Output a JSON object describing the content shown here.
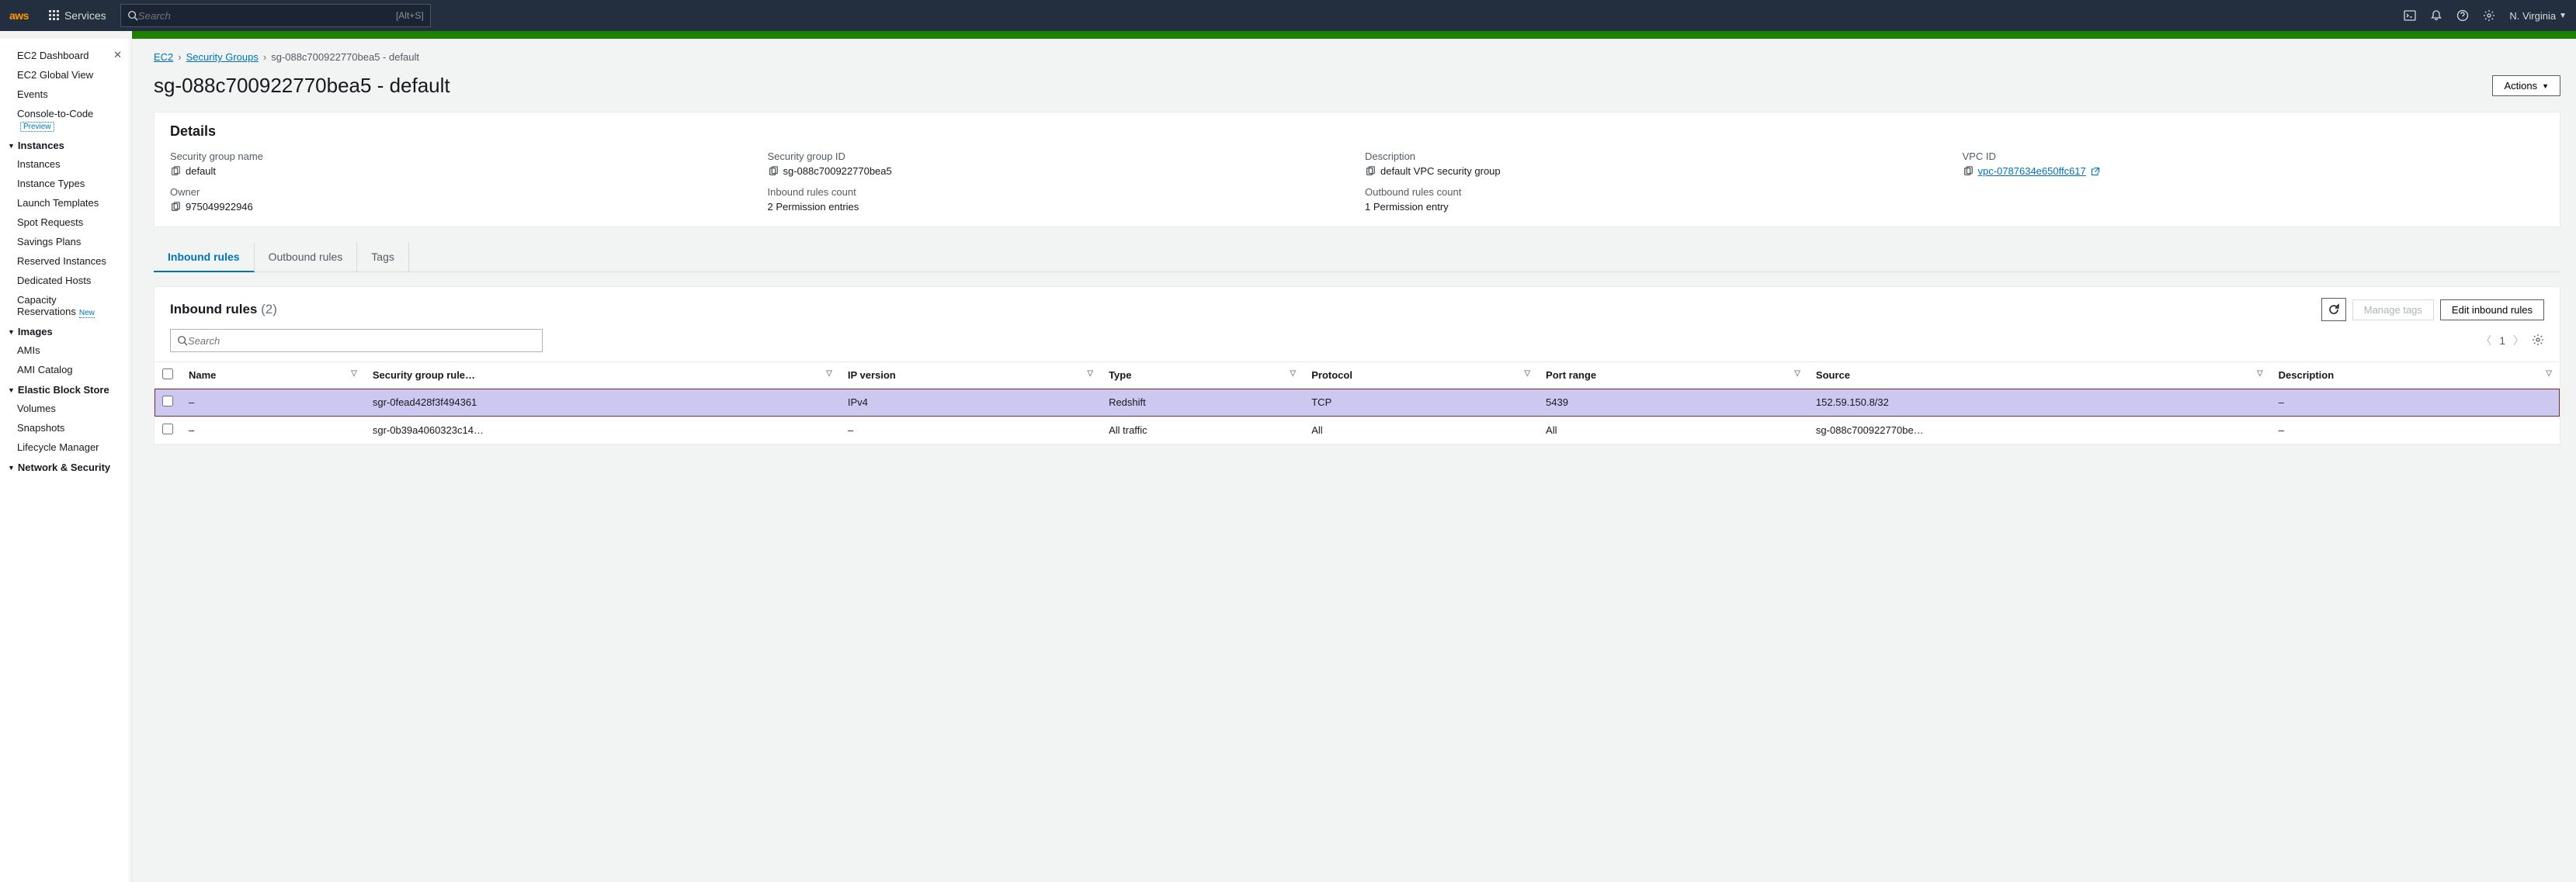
{
  "topnav": {
    "logo": "aws",
    "services_label": "Services",
    "search_placeholder": "Search",
    "search_shortcut": "[Alt+S]",
    "region": "N. Virginia"
  },
  "sidebar": {
    "top_items": [
      {
        "label": "EC2 Dashboard",
        "close": true
      },
      {
        "label": "EC2 Global View"
      },
      {
        "label": "Events"
      },
      {
        "label": "Console-to-Code",
        "badge": "Preview"
      }
    ],
    "sections": [
      {
        "title": "Instances",
        "items": [
          {
            "label": "Instances"
          },
          {
            "label": "Instance Types"
          },
          {
            "label": "Launch Templates"
          },
          {
            "label": "Spot Requests"
          },
          {
            "label": "Savings Plans"
          },
          {
            "label": "Reserved Instances"
          },
          {
            "label": "Dedicated Hosts"
          },
          {
            "label": "Capacity Reservations",
            "badge": "New"
          }
        ]
      },
      {
        "title": "Images",
        "items": [
          {
            "label": "AMIs"
          },
          {
            "label": "AMI Catalog"
          }
        ]
      },
      {
        "title": "Elastic Block Store",
        "items": [
          {
            "label": "Volumes"
          },
          {
            "label": "Snapshots"
          },
          {
            "label": "Lifecycle Manager"
          }
        ]
      },
      {
        "title": "Network & Security",
        "items": []
      }
    ]
  },
  "breadcrumb": {
    "items": [
      {
        "label": "EC2",
        "link": true
      },
      {
        "label": "Security Groups",
        "link": true
      },
      {
        "label": "sg-088c700922770bea5 - default",
        "link": false
      }
    ]
  },
  "page": {
    "title": "sg-088c700922770bea5 - default",
    "actions_label": "Actions"
  },
  "details": {
    "header": "Details",
    "fields": {
      "sg_name": {
        "label": "Security group name",
        "value": "default"
      },
      "sg_id": {
        "label": "Security group ID",
        "value": "sg-088c700922770bea5"
      },
      "description": {
        "label": "Description",
        "value": "default VPC security group"
      },
      "vpc_id": {
        "label": "VPC ID",
        "value": "vpc-0787634e650ffc617",
        "link": true
      },
      "owner": {
        "label": "Owner",
        "value": "975049922946"
      },
      "inbound_count": {
        "label": "Inbound rules count",
        "value": "2 Permission entries"
      },
      "outbound_count": {
        "label": "Outbound rules count",
        "value": "1 Permission entry"
      }
    }
  },
  "tabs": {
    "inbound": "Inbound rules",
    "outbound": "Outbound rules",
    "tags": "Tags",
    "active": "inbound"
  },
  "rules": {
    "header": "Inbound rules",
    "count": "(2)",
    "manage_tags": "Manage tags",
    "edit": "Edit inbound rules",
    "search_placeholder": "Search",
    "page": "1",
    "columns": [
      "Name",
      "Security group rule…",
      "IP version",
      "Type",
      "Protocol",
      "Port range",
      "Source",
      "Description"
    ],
    "rows": [
      {
        "name": "–",
        "rule_id": "sgr-0fead428f3f494361",
        "ip": "IPv4",
        "type": "Redshift",
        "protocol": "TCP",
        "port": "5439",
        "source": "152.59.150.8/32",
        "desc": "–",
        "hl": true
      },
      {
        "name": "–",
        "rule_id": "sgr-0b39a4060323c14…",
        "ip": "–",
        "type": "All traffic",
        "protocol": "All",
        "port": "All",
        "source": "sg-088c700922770be…",
        "desc": "–",
        "hl": false
      }
    ]
  }
}
